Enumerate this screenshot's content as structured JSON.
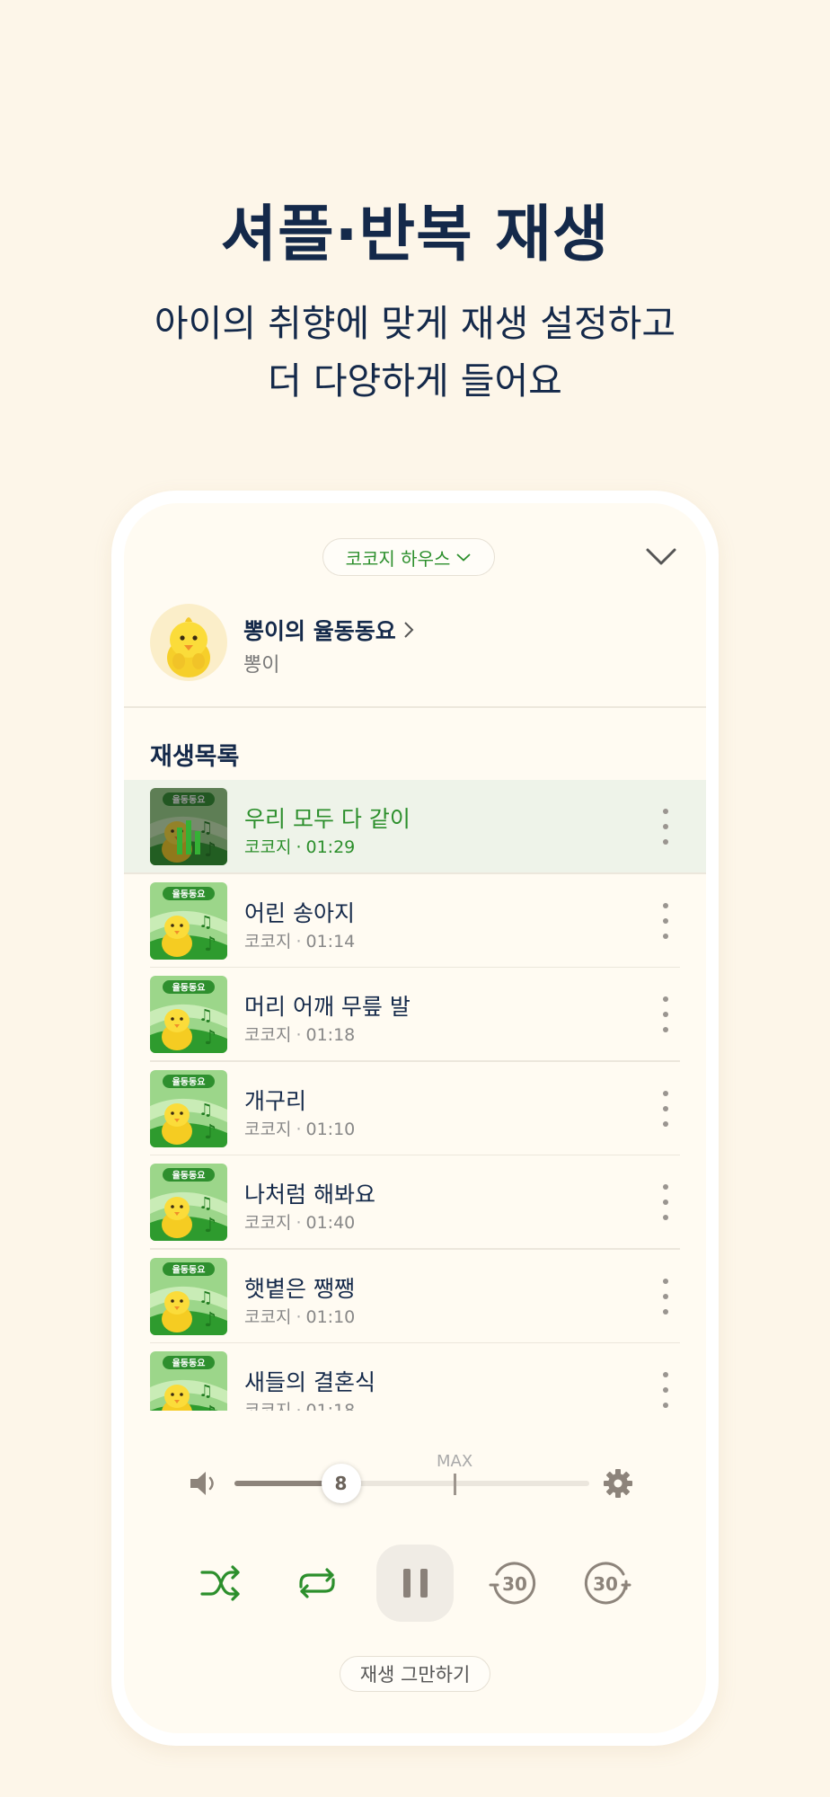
{
  "headline": "셔플·반복 재생",
  "subline": [
    "아이의 취향에 맞게 재생 설정하고",
    "더 다양하게 들어요"
  ],
  "player": {
    "house_label": "코코지 하우스",
    "playlist_title": "뽕이의 율동동요",
    "playlist_owner": "뽕이",
    "section_title": "재생목록",
    "thumb_badge": "율동동요",
    "songs": [
      {
        "title": "우리 모두 다 같이",
        "artist": "코코지",
        "duration": "01:29",
        "active": true
      },
      {
        "title": "어린 송아지",
        "artist": "코코지",
        "duration": "01:14",
        "active": false
      },
      {
        "title": "머리 어깨 무릎 발",
        "artist": "코코지",
        "duration": "01:18",
        "active": false
      },
      {
        "title": "개구리",
        "artist": "코코지",
        "duration": "01:10",
        "active": false
      },
      {
        "title": "나처럼 해봐요",
        "artist": "코코지",
        "duration": "01:40",
        "active": false
      },
      {
        "title": "햇볕은 쨍쨍",
        "artist": "코코지",
        "duration": "01:10",
        "active": false
      },
      {
        "title": "새들의 결혼식",
        "artist": "코코지",
        "duration": "01:18",
        "active": false
      }
    ],
    "volume": {
      "value": "8",
      "level_fraction": 0.3,
      "max_label": "MAX",
      "max_fraction": 0.62
    },
    "skip_back_label": "30",
    "skip_forward_label": "30",
    "stop_label": "재생 그만하기"
  },
  "colors": {
    "background": "#fdf6e9",
    "navy": "#14294a",
    "accent_green": "#2c8f2c",
    "active_row": "#eef3e9"
  },
  "icons": [
    "chevron-down-icon",
    "chevron-right-icon",
    "speaker-icon",
    "gear-icon",
    "shuffle-icon",
    "repeat-icon",
    "pause-icon",
    "rewind-30-icon",
    "forward-30-icon",
    "more-vertical-icon"
  ]
}
